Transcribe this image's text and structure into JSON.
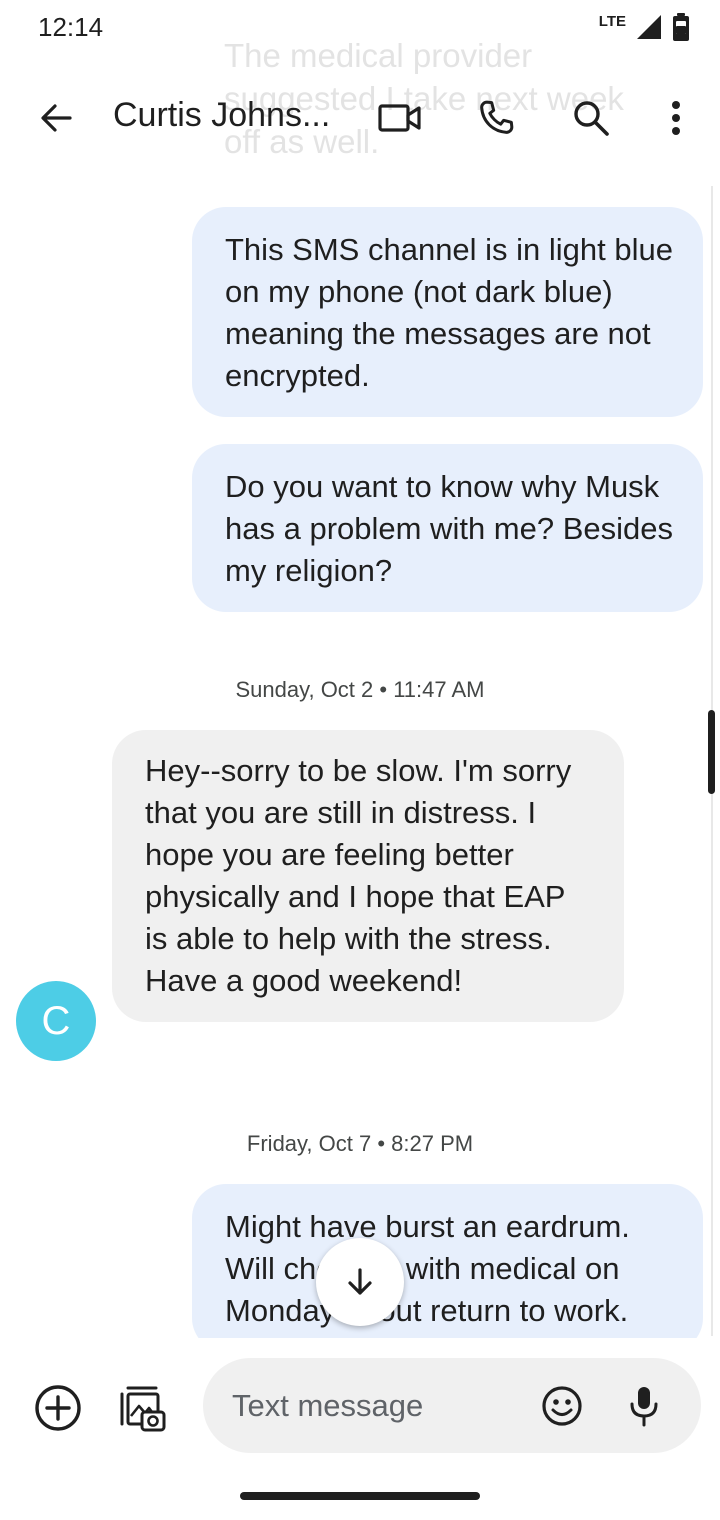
{
  "status_bar": {
    "time": "12:14",
    "network": "LTE"
  },
  "ghost_text": "The medical provider suggested I take next week off as well.",
  "header": {
    "contact_name": "Curtis Johns..."
  },
  "messages": [
    {
      "direction": "outgoing",
      "text": "This SMS channel is in light blue on my phone (not dark blue) meaning the messages are not encrypted."
    },
    {
      "direction": "outgoing",
      "text": "Do you want to know why Musk has a problem with me? Besides my religion?"
    },
    {
      "direction": "timestamp",
      "text": "Sunday, Oct 2 • 11:47 AM"
    },
    {
      "direction": "incoming",
      "text": "Hey--sorry to be slow.  I'm sorry that you are still in distress.  I hope you are feeling better physically and I hope that EAP is able to help with the stress.  Have a good weekend!"
    },
    {
      "direction": "timestamp",
      "text": "Friday, Oct 7 • 8:27 PM"
    },
    {
      "direction": "outgoing",
      "text": "Might have burst an eardrum. Will check in with medical on Monday about return to work."
    }
  ],
  "avatar": {
    "initial": "C",
    "color": "#4dcde6"
  },
  "compose": {
    "placeholder": "Text message"
  },
  "colors": {
    "outgoing_bubble": "#e7effc",
    "incoming_bubble": "#f0f0f0",
    "text": "#1f1f1f"
  }
}
